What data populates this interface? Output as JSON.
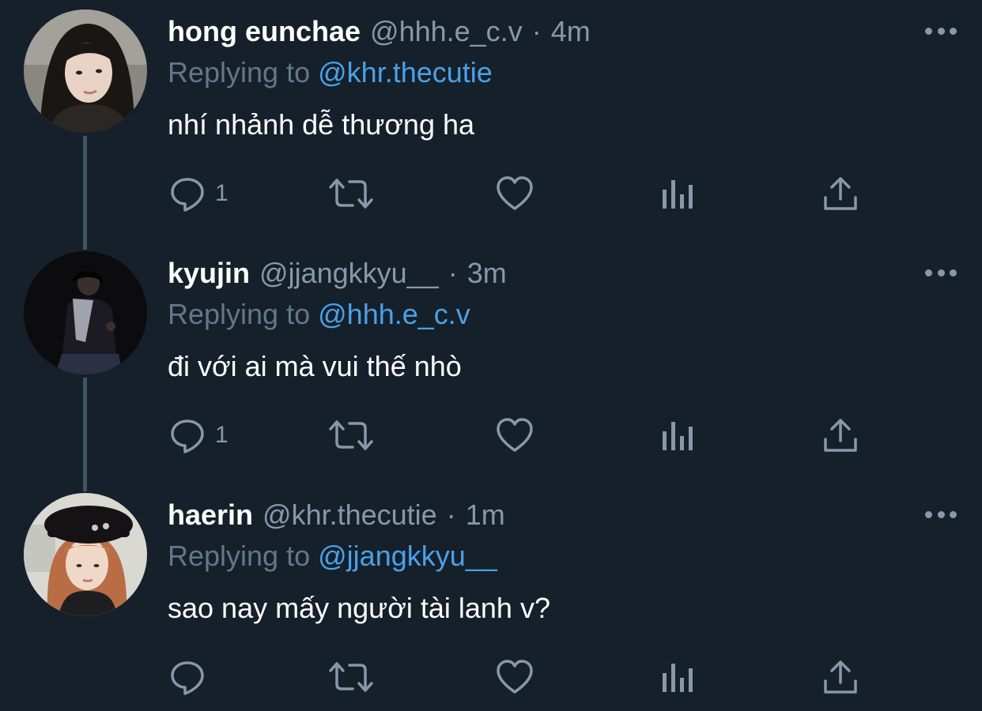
{
  "tweets": [
    {
      "display_name": "hong eunchae",
      "handle": "@hhh.e_c.v",
      "separator": "·",
      "time": "4m",
      "replying_label": "Replying to",
      "replying_to": "@khr.thecutie",
      "text": "nhí nhảnh dễ thương ha",
      "reply_count": "1"
    },
    {
      "display_name": "kyujin",
      "handle": "@jjangkkyu__",
      "separator": "·",
      "time": "3m",
      "replying_label": "Replying to",
      "replying_to": "@hhh.e_c.v",
      "text": "đi với ai mà vui thế nhò",
      "reply_count": "1"
    },
    {
      "display_name": "haerin",
      "handle": "@khr.thecutie",
      "separator": "·",
      "time": "1m",
      "replying_label": "Replying to",
      "replying_to": "@jjangkkyu__",
      "text": "sao nay mấy người tài lanh v?",
      "reply_count": ""
    }
  ],
  "icons": {
    "reply": "reply-icon",
    "retweet": "retweet-icon",
    "like": "heart-icon",
    "analytics": "analytics-icon",
    "share": "share-icon",
    "more": "more-options-icon"
  },
  "colors": {
    "background": "#15202b",
    "primary_text": "#ffffff",
    "secondary_text": "#8899a6",
    "mention": "#4aa1e8",
    "thread_line": "#3d5466"
  }
}
